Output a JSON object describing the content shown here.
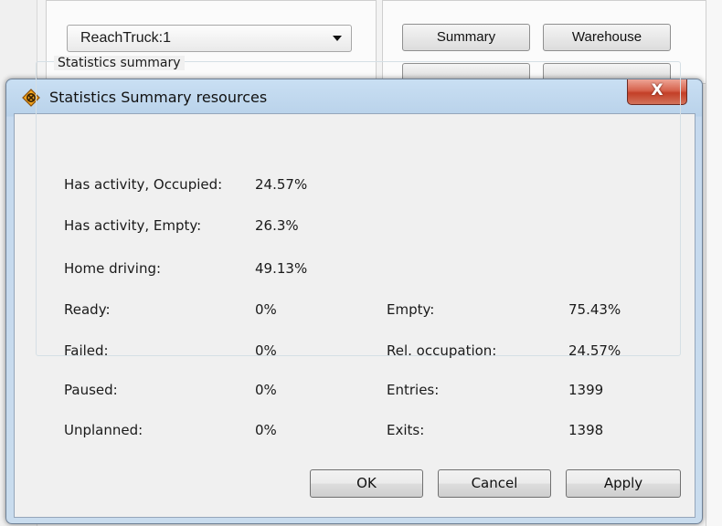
{
  "background": {
    "combo_value": "ReachTruck:1",
    "buttons": {
      "summary": "Summary",
      "warehouse": "Warehouse"
    }
  },
  "dialog": {
    "title": "Statistics Summary resources",
    "close_label": "X",
    "group_title": "Statistics summary",
    "stats_left": [
      {
        "label": "Has activity, Occupied:",
        "value": "24.57%"
      },
      {
        "label": "Has activity, Empty:",
        "value": "26.3%"
      },
      {
        "label": "Home driving:",
        "value": "49.13%"
      },
      {
        "label": "Ready:",
        "value": "0%"
      },
      {
        "label": "Failed:",
        "value": "0%"
      },
      {
        "label": "Paused:",
        "value": "0%"
      },
      {
        "label": "Unplanned:",
        "value": "0%"
      }
    ],
    "stats_right": [
      {
        "label": "Empty:",
        "value": "75.43%"
      },
      {
        "label": "Rel. occupation:",
        "value": "24.57%"
      },
      {
        "label": "Entries:",
        "value": "1399"
      },
      {
        "label": "Exits:",
        "value": "1398"
      }
    ],
    "buttons": {
      "ok": "OK",
      "cancel": "Cancel",
      "apply": "Apply"
    }
  }
}
